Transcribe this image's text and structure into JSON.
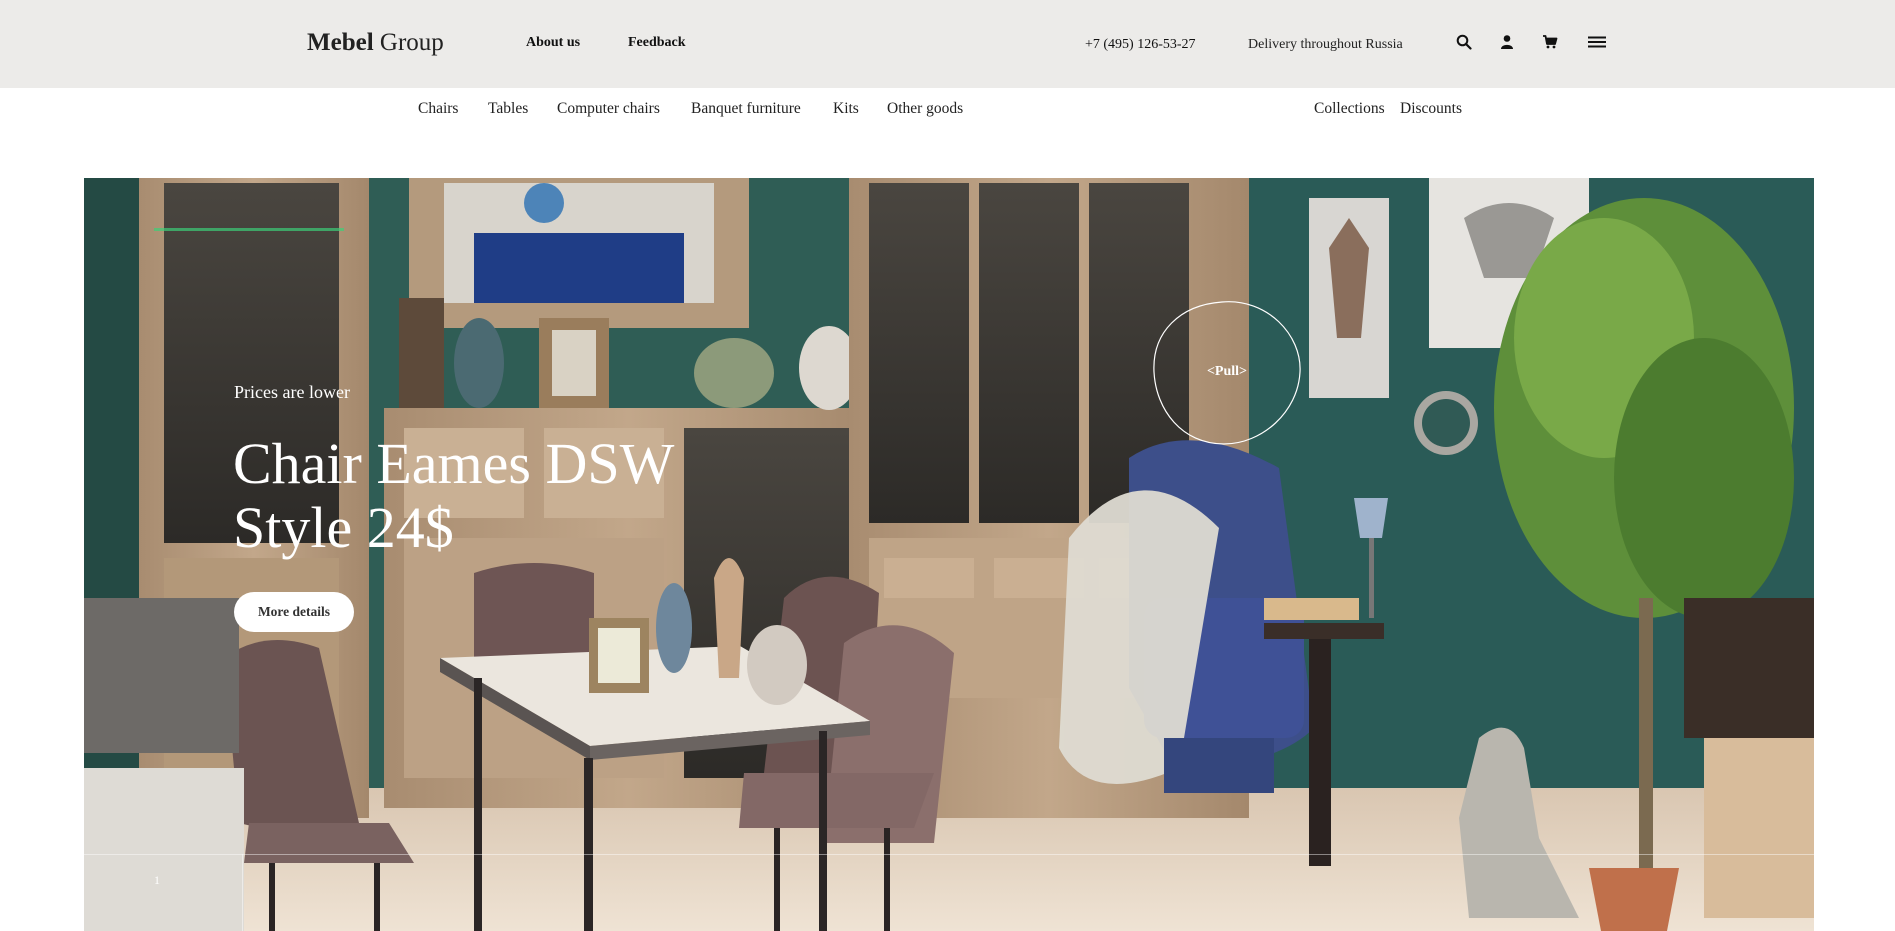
{
  "header": {
    "logo_bold": "Mebel",
    "logo_thin": "Group",
    "links": [
      "About us",
      "Feedback"
    ],
    "phone": "+7 (495) 126-53-27",
    "delivery": "Delivery throughout Russia",
    "icons": [
      "search-icon",
      "user-icon",
      "cart-icon",
      "menu-icon"
    ]
  },
  "categories": {
    "left": [
      "Chairs",
      "Tables",
      "Computer chairs",
      "Banquet furniture",
      "Kits",
      "Other goods"
    ],
    "right": [
      "Collections",
      "Discounts"
    ]
  },
  "hero": {
    "kicker": "Prices are lower",
    "title": "Chair Eames DSW Style 24$",
    "button": "More details",
    "pull": "<Pull>",
    "slide_number": "1"
  },
  "colors": {
    "header_bg": "#ecebe9",
    "wall": "#2f5d55",
    "cabinet": "#b59a7e",
    "armchair": "#3d4f8a",
    "chair": "#6b5452"
  }
}
